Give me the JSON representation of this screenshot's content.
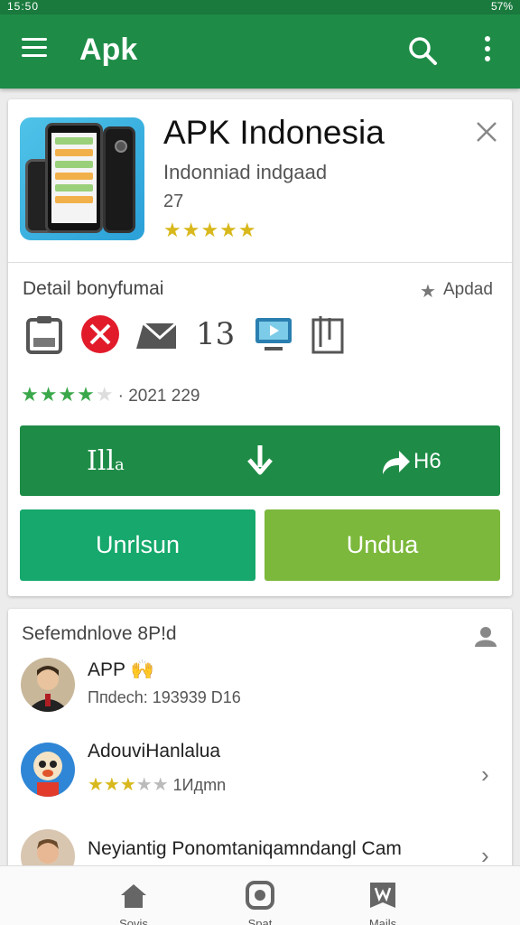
{
  "status": {
    "left": "15:50",
    "right": "57%"
  },
  "appbar": {
    "title": "Apk"
  },
  "app": {
    "name": "APK Indonesia",
    "subtitle": "Indonniad indgaad",
    "count": "27",
    "stars": "★★★★★"
  },
  "details": {
    "title": "Detail bonyfumai",
    "star_glyph": "★",
    "apply_label": "Apdad",
    "icons": [
      "clipboard-icon",
      "close-circle-icon",
      "mail-icon",
      "calendar-13-icon",
      "tv-icon",
      "book-icon"
    ],
    "calendar_number": "13",
    "rating_filled": "★★★★",
    "rating_empty": "★",
    "date": "· 2021 229"
  },
  "buttons": {
    "left_text": "Ill",
    "left_small": "a",
    "right_text": "H6",
    "uninstall": "Unrlsun",
    "open": "Undua"
  },
  "similar": {
    "title": "Sefemdnlove 8P!d",
    "items": [
      {
        "title": "APP",
        "badge": "🙌",
        "subtitle": "Ппdесh: 193939 D16"
      },
      {
        "title": "AdouviHanlalua",
        "stars_filled": "★★★",
        "stars_empty": "★★",
        "subtitle": "1Идmn"
      },
      {
        "title": "Neyiantig Ponomtaniqamndangl Cam"
      }
    ]
  },
  "bottom_nav": {
    "home": "Sovis",
    "search": "Spat",
    "library": "Mails"
  },
  "colors": {
    "primary": "#1e8c47",
    "uninstall": "#16a86c",
    "open": "#7cb83b",
    "star": "#d8b81c",
    "star_green": "#3aa84a"
  }
}
